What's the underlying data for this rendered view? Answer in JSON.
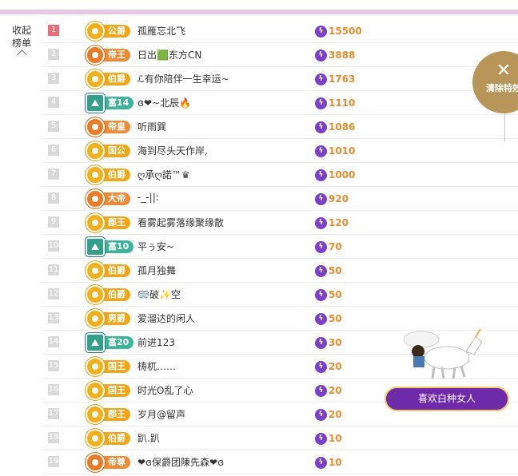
{
  "sidebar": {
    "toggle_line1": "收起",
    "toggle_line2": "榜单"
  },
  "effects": {
    "clear_label": "清除特效"
  },
  "gift": {
    "banner_label": "喜欢白种女人"
  },
  "ranking": [
    {
      "rank": "1",
      "badge_color": "gold",
      "title": "公爵",
      "name": "孤雁忘北飞",
      "score": "15500"
    },
    {
      "rank": "2",
      "badge_color": "orange",
      "title": "帝王",
      "name": "日出🟩东方CN",
      "score": "3888"
    },
    {
      "rank": "3",
      "badge_color": "gold",
      "title": "伯爵",
      "name": "ℒ有你陪伴一生幸运~",
      "score": "1763"
    },
    {
      "rank": "4",
      "badge_color": "teal",
      "title": "富14",
      "name": "ɞ❤~北辰🔥",
      "score": "1110"
    },
    {
      "rank": "5",
      "badge_color": "orange",
      "title": "帝皇",
      "name": "听雨巽",
      "score": "1086"
    },
    {
      "rank": "6",
      "badge_color": "gold",
      "title": "国公",
      "name": "海到尽头天作岸,",
      "score": "1010"
    },
    {
      "rank": "7",
      "badge_color": "gold",
      "title": "伯爵",
      "name": "ღ承ღ諾™♛",
      "score": "1000"
    },
    {
      "rank": "8",
      "badge_color": "orange",
      "title": "大帝",
      "name": "-_-||:",
      "score": "920"
    },
    {
      "rank": "9",
      "badge_color": "gold",
      "title": "郡王",
      "name": "看雾起雾落缘聚缘散",
      "score": "120"
    },
    {
      "rank": "10",
      "badge_color": "teal",
      "title": "富10",
      "name": "平ぅ安~",
      "score": "70"
    },
    {
      "rank": "11",
      "badge_color": "gold",
      "title": "伯爵",
      "name": "孤月独舞",
      "score": "50"
    },
    {
      "rank": "12",
      "badge_color": "gold",
      "title": "伯爵",
      "name": "🥽破✨空",
      "score": "50"
    },
    {
      "rank": "13",
      "badge_color": "gold",
      "title": "男爵",
      "name": "爱溜达的闲人",
      "score": "50"
    },
    {
      "rank": "14",
      "badge_color": "teal",
      "title": "富20",
      "name": "前进123",
      "score": "30"
    },
    {
      "rank": "15",
      "badge_color": "gold",
      "title": "国王",
      "name": "梼杌……",
      "score": "20"
    },
    {
      "rank": "16",
      "badge_color": "gold",
      "title": "国王",
      "name": "时光ʘ乱了心",
      "score": "20"
    },
    {
      "rank": "17",
      "badge_color": "gold",
      "title": "郡王",
      "name": "岁月@留声",
      "score": "20"
    },
    {
      "rank": "18",
      "badge_color": "gold",
      "title": "伯爵",
      "name": "趴.趴",
      "score": "10"
    },
    {
      "rank": "19",
      "badge_color": "orange",
      "title": "帝尊",
      "name": "❤ɞ保爵团陳先森❤ɞ",
      "score": "10"
    }
  ]
}
